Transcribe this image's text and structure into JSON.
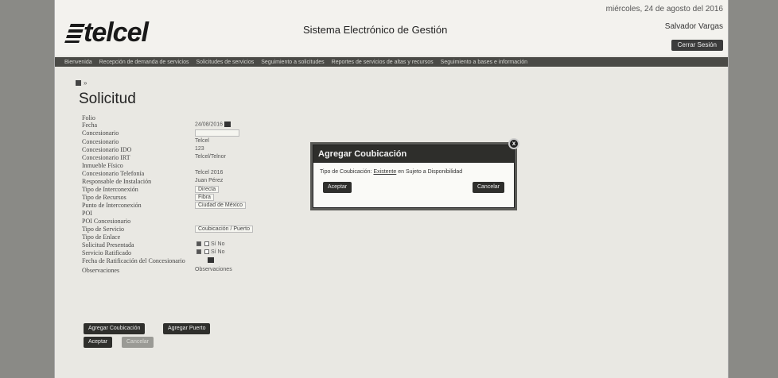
{
  "header": {
    "logo": "telcel",
    "system_title": "Sistema Electrónico de Gestión",
    "date": "miércoles, 24 de agosto del 2016",
    "user": "Salvador Vargas",
    "logout_label": "Cerrar Sesión"
  },
  "nav": [
    "Bienvenida",
    "Recepción de demanda de servicios",
    "Solicitudes de servicios",
    "Seguimiento a solicitudes",
    "Reportes de servicios de altas y recursos",
    "Seguimiento a bases e información"
  ],
  "breadcrumb": "»",
  "page_title": "Solicitud",
  "form": {
    "rows": [
      {
        "label": "Folio",
        "value": ""
      },
      {
        "label": "Fecha",
        "value": "24/08/2016"
      },
      {
        "label": "Concesionario",
        "value": ""
      },
      {
        "label": "Concesionario",
        "value": "Telcel"
      },
      {
        "label": "Concesionario IDO",
        "value": "123"
      },
      {
        "label": "Concesionario IRT",
        "value": "Telcel/Telnor"
      },
      {
        "label": "Inmueble Físico",
        "value": ""
      },
      {
        "label": "Concesionario Telefonía",
        "value": "Telcel 2016"
      },
      {
        "label": "Responsable de Instalación",
        "value": "Juan Pérez"
      },
      {
        "label": "Tipo de Interconexión",
        "value": "Directa"
      },
      {
        "label": "Tipo de Recursos",
        "value": "Fibra"
      },
      {
        "label": "Punto de Interconexión",
        "value": "Ciudad de México"
      },
      {
        "label": "POI",
        "value": ""
      },
      {
        "label": "POI Concesionario",
        "value": ""
      },
      {
        "label": "Tipo de Servicio",
        "value": "Coubicación / Puerto"
      },
      {
        "label": "Tipo de Enlace",
        "value": ""
      },
      {
        "label": "Solicitud Presentada",
        "value": "Sí  No"
      },
      {
        "label": "Servicio Ratificado",
        "value": "Sí  No"
      },
      {
        "label": "Fecha de Ratificación del Concesionario",
        "value": ""
      },
      {
        "label": "Observaciones",
        "value": "Observaciones"
      }
    ],
    "buttons": {
      "add_colocation": "Agregar Coubicación",
      "add_port": "Agregar Puerto",
      "accept": "Aceptar",
      "cancel": "Cancelar"
    }
  },
  "modal": {
    "title": "Agregar Coubicación",
    "prompt": "Tipo de Coubicación:",
    "option": "Existente",
    "rest": "en Sujeto a Disponibilidad",
    "accept": "Aceptar",
    "cancel": "Cancelar",
    "close": "x"
  }
}
